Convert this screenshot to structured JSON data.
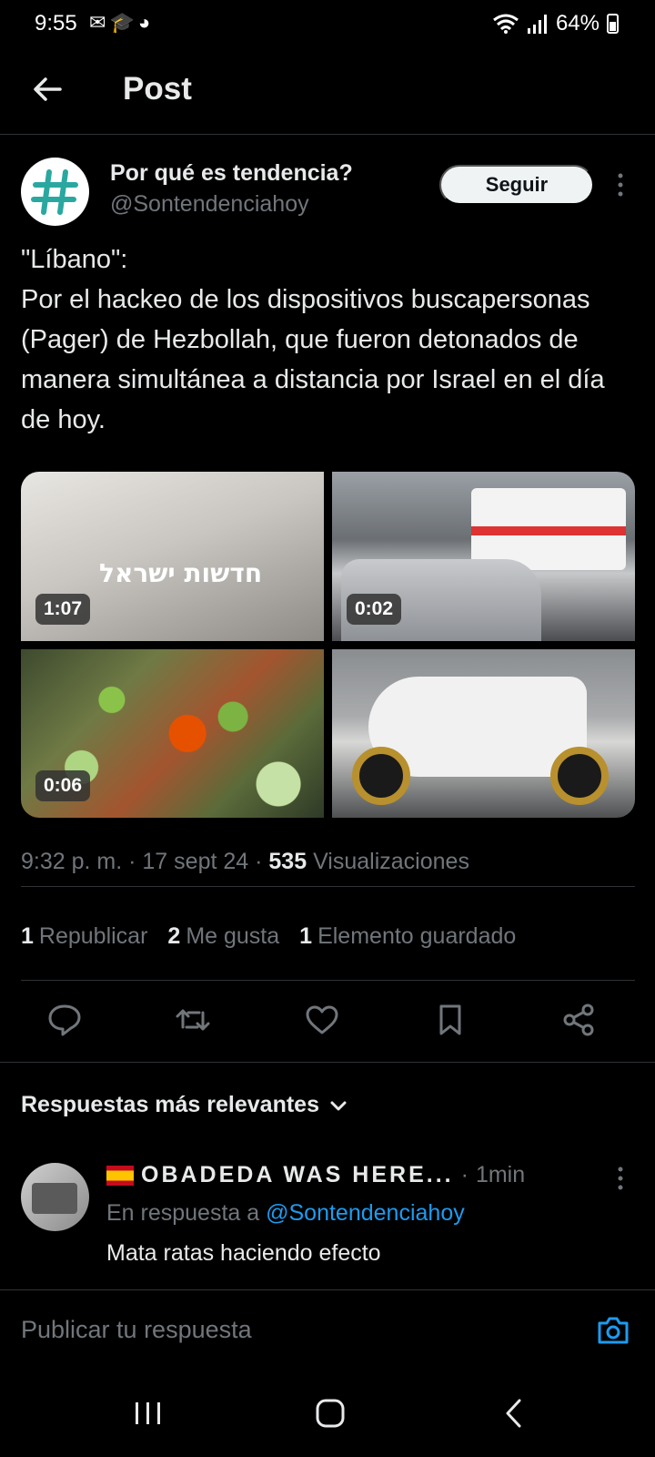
{
  "status_bar": {
    "time": "9:55",
    "battery": "64%",
    "notification_icons": [
      "gmail-icon",
      "graduation-icon",
      "app-icon"
    ]
  },
  "header": {
    "title": "Post"
  },
  "post": {
    "author_name": "Por qué es tendencia?",
    "author_handle": "@Sontendenciahoy",
    "follow_label": "Seguir",
    "text": "\"Líbano\":\nPor el hackeo de los dispositivos buscapersonas (Pager) de Hezbollah, que fueron detonados de manera simultánea a distancia por Israel en el día de hoy.",
    "media": [
      {
        "duration": "1:07",
        "overlay_text": "חדשות ישראל"
      },
      {
        "duration": "0:02"
      },
      {
        "duration": "0:06"
      },
      {
        "duration": ""
      }
    ],
    "time": "9:32 p. m.",
    "date": "17 sept 24",
    "views_count": "535",
    "views_label": "Visualizaciones",
    "reposts_count": "1",
    "reposts_label": "Republicar",
    "likes_count": "2",
    "likes_label": "Me gusta",
    "bookmarks_count": "1",
    "bookmarks_label": "Elemento guardado"
  },
  "replies": {
    "sort_label": "Respuestas más relevantes",
    "items": [
      {
        "name": "OBADEDA WAS HERE...",
        "time": "1min",
        "reply_prefix": "En respuesta a",
        "reply_handle": "@Sontendenciahoy",
        "text": "Mata ratas haciendo efecto"
      }
    ]
  },
  "composer": {
    "placeholder": "Publicar tu respuesta"
  },
  "colors": {
    "background": "#000000",
    "accent": "#1d9bf0",
    "muted": "#71767b",
    "text": "#e7e9ea"
  }
}
